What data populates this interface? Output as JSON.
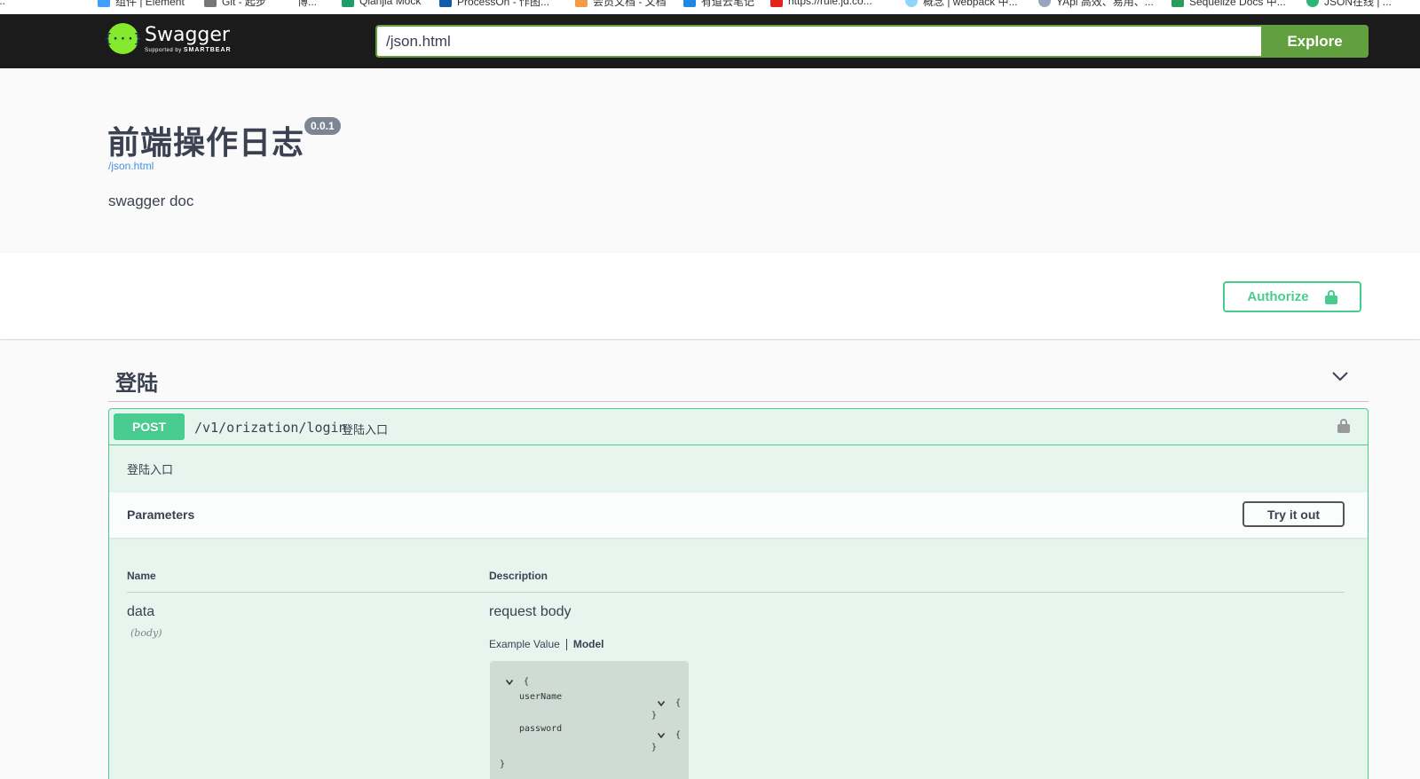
{
  "bookmarks": [
    {
      "label": "...",
      "color": "#4285f4"
    },
    {
      "label": "组件 | Element",
      "color": "#409eff"
    },
    {
      "label": "Git - 起步",
      "color": "#777777"
    },
    {
      "label": "博...",
      "color": "#999999"
    },
    {
      "label": "Qianjia Mock",
      "color": "#1a9f6c"
    },
    {
      "label": "ProcessOn - 作图...",
      "color": "#0f5ca8"
    },
    {
      "label": "会员文档 - 文档",
      "color": "#f39c48"
    },
    {
      "label": "有道云笔记",
      "color": "#1e88e5"
    },
    {
      "label": "https://rule.jd.co...",
      "color": "#e1251b"
    },
    {
      "label": "概念 | webpack 中...",
      "color": "#8ed6fb"
    },
    {
      "label": "YApi 高效、易用、...",
      "color": "#9aa5bd"
    },
    {
      "label": "Sequelize Docs 中...",
      "color": "#2a9d5b"
    },
    {
      "label": "JSON在线 | ...",
      "color": "#2bb673"
    }
  ],
  "topbar": {
    "logo_mark": "{···}",
    "logo_title": "Swagger",
    "logo_sub_prefix": "Supported by ",
    "logo_sub_brand": "SMARTBEAR",
    "url_value": "/json.html",
    "explore_label": "Explore"
  },
  "info": {
    "title": "前端操作日志",
    "version": "0.0.1",
    "base_url": "/json.html",
    "description": "swagger doc"
  },
  "scheme": {
    "authorize_label": "Authorize"
  },
  "tag": {
    "name": "登陆"
  },
  "operation": {
    "method": "POST",
    "path": "/v1/orization/login",
    "summary": "登陆入口",
    "description": "登陆入口",
    "parameters_title": "Parameters",
    "try_label": "Try it out",
    "col_name": "Name",
    "col_description": "Description",
    "param": {
      "name": "data",
      "in": "(body)",
      "description": "request body"
    },
    "tabs": {
      "example": "Example Value",
      "model": "Model"
    },
    "model": {
      "open_brace": "{",
      "close_brace": "}",
      "fields": [
        {
          "name": "userName",
          "open": "{",
          "close": "}"
        },
        {
          "name": "password",
          "open": "{",
          "close": "}"
        }
      ]
    }
  },
  "colors": {
    "topbar_bg": "#1b1b1b",
    "explore_green": "#62a03f",
    "post_green": "#49cc90",
    "logo_green": "#85ea2d",
    "link_blue": "#4990e2"
  }
}
